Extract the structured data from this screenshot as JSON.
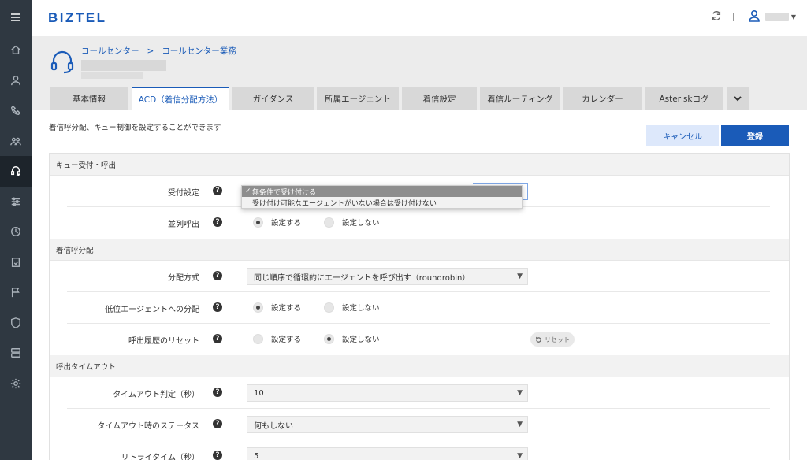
{
  "app": {
    "logo": "BIZTEL"
  },
  "breadcrumb": {
    "items": [
      "コールセンター",
      "コールセンター業務"
    ],
    "separator": ">"
  },
  "tabs": [
    {
      "label": "基本情報",
      "active": false
    },
    {
      "label": "ACD（着信分配方法）",
      "active": true
    },
    {
      "label": "ガイダンス",
      "active": false
    },
    {
      "label": "所属エージェント",
      "active": false
    },
    {
      "label": "着信設定",
      "active": false
    },
    {
      "label": "着信ルーティング",
      "active": false
    },
    {
      "label": "カレンダー",
      "active": false
    },
    {
      "label": "Asteriskログ",
      "active": false
    }
  ],
  "description": "着信呼分配、キュー制御を設定することができます",
  "buttons": {
    "cancel": "キャンセル",
    "register": "登録",
    "reset": "リセット"
  },
  "sections": {
    "queue": {
      "title": "キュー受付・呼出",
      "accept": {
        "label": "受付設定"
      },
      "parallel": {
        "label": "並列呼出",
        "options": [
          "設定する",
          "設定しない"
        ],
        "selected": 0
      }
    },
    "distribution": {
      "title": "着信呼分配",
      "method": {
        "label": "分配方式",
        "value": "同じ順序で循環的にエージェントを呼び出す（roundrobin）"
      },
      "low_priority": {
        "label": "低位エージェントへの分配",
        "options": [
          "設定する",
          "設定しない"
        ],
        "selected": 0
      },
      "history_reset": {
        "label": "呼出履歴のリセット",
        "options": [
          "設定する",
          "設定しない"
        ],
        "selected": 1
      }
    },
    "timeout": {
      "title": "呼出タイムアウト",
      "judge": {
        "label": "タイムアウト判定（秒）",
        "value": "10"
      },
      "status": {
        "label": "タイムアウト時のステータス",
        "value": "何もしない"
      },
      "retry": {
        "label": "リトライタイム（秒）",
        "value": "5"
      }
    }
  },
  "dropdown": {
    "options": [
      "無条件で受け付ける",
      "受け付け可能なエージェントがいない場合は受け付けない"
    ],
    "selected": 0,
    "check_mark": "✓"
  },
  "help_glyph": "?",
  "select_arrow": "▼",
  "colors": {
    "brand": "#1a5bb8",
    "sidebar": "#2f3841",
    "cancel_bg": "#dde8fb"
  }
}
